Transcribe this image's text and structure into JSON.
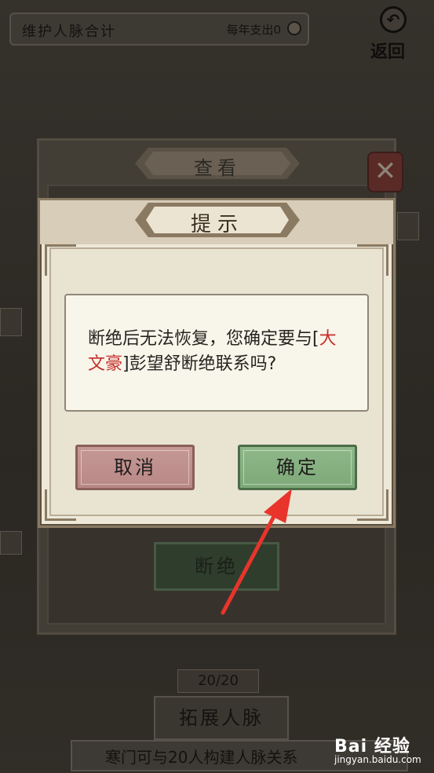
{
  "top_bar": {
    "title": "维护人脉合计",
    "cost_label": "每年支出0"
  },
  "back_button": {
    "label": "返回"
  },
  "background_panel": {
    "title": "查看",
    "close_icon": "x-icon",
    "sever_button_label": "断绝",
    "connections_count": "20/20",
    "expand_button_label": "拓展人脉",
    "footer_text": "寒门可与20人构建人脉关系"
  },
  "dialog": {
    "title": "提示",
    "message_parts": {
      "before": "断绝后无法恢复，您确定要与[",
      "highlight": "大文豪",
      "after": "]彭望舒断绝联系吗?"
    },
    "cancel_label": "取消",
    "confirm_label": "确定"
  },
  "watermark": {
    "brand": "Bai 经验",
    "url": "jingyan.baidu.com"
  },
  "colors": {
    "highlight": "#c4302a",
    "annotation_arrow": "#e8342b"
  }
}
